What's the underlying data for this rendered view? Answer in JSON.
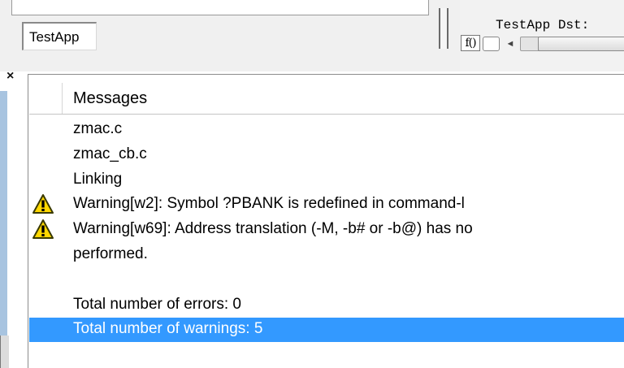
{
  "workspace": {
    "tab_label": "TestApp"
  },
  "editor": {
    "line_text": "TestApp Dst:",
    "fn_button_label": "f()"
  },
  "messages": {
    "column_header": "Messages",
    "rows": [
      {
        "text": "zmac.c",
        "icon": ""
      },
      {
        "text": "zmac_cb.c",
        "icon": ""
      },
      {
        "text": "Linking",
        "icon": ""
      },
      {
        "text": "Warning[w2]: Symbol ?PBANK is redefined in command-l",
        "icon": "warning-icon"
      },
      {
        "text": "Warning[w69]: Address translation (-M, -b# or -b@) has no",
        "icon": "warning-icon"
      },
      {
        "text": "performed.",
        "icon": ""
      },
      {
        "text": "",
        "icon": ""
      },
      {
        "text": "Total number of errors: 0",
        "icon": ""
      },
      {
        "text": "Total number of warnings: 5",
        "icon": "",
        "selected": true
      }
    ]
  },
  "colors": {
    "selection": "#3399ff",
    "warning": "#ffd800"
  }
}
